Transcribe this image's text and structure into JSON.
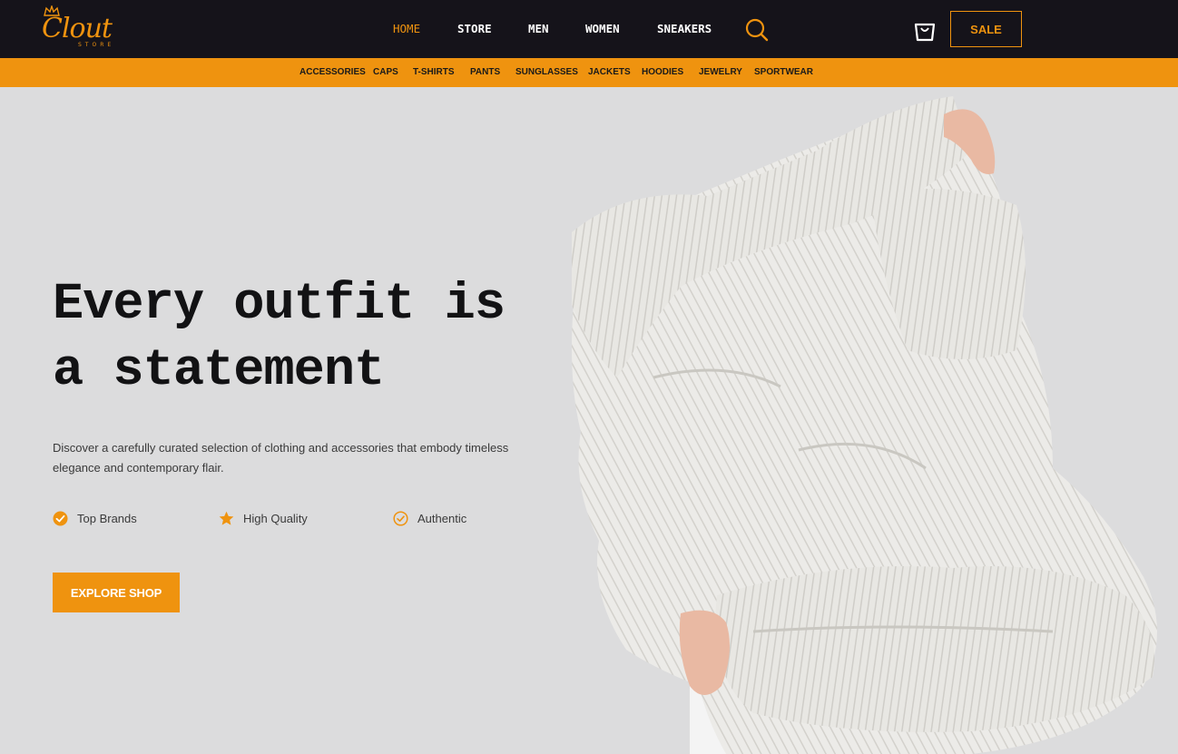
{
  "brand": {
    "logo_text": "Clout",
    "logo_sub": "STORE",
    "accent_color": "#ef930f",
    "dark_color": "#15131a"
  },
  "nav": {
    "items": [
      {
        "label": "HOME",
        "active": true
      },
      {
        "label": "STORE",
        "active": false
      },
      {
        "label": "MEN",
        "active": false
      },
      {
        "label": "WOMEN",
        "active": false
      },
      {
        "label": "SNEAKERS",
        "active": false
      }
    ],
    "search_icon": "search-icon",
    "cart_icon": "shopping-bag-icon",
    "sale_label": "SALE"
  },
  "categories": [
    "ACCESSORIES",
    "CAPS",
    "T-SHIRTS",
    "PANTS",
    "SUNGLASSES",
    "JACKETS",
    "HOODIES",
    "JEWELRY",
    "SPORTWEAR"
  ],
  "hero": {
    "title_line1": "Every outfit is",
    "title_line2": "a statement",
    "description": "Discover a carefully curated selection of clothing and accessories that embody timeless elegance and contemporary flair.",
    "features": [
      {
        "label": "Top Brands",
        "icon": "check-circle-filled-icon"
      },
      {
        "label": "High Quality",
        "icon": "star-icon"
      },
      {
        "label": "Authentic",
        "icon": "check-circle-outline-icon"
      }
    ],
    "cta_label": "EXPLORE SHOP",
    "image": "person-pulling-white-knit-sweater-over-head"
  }
}
